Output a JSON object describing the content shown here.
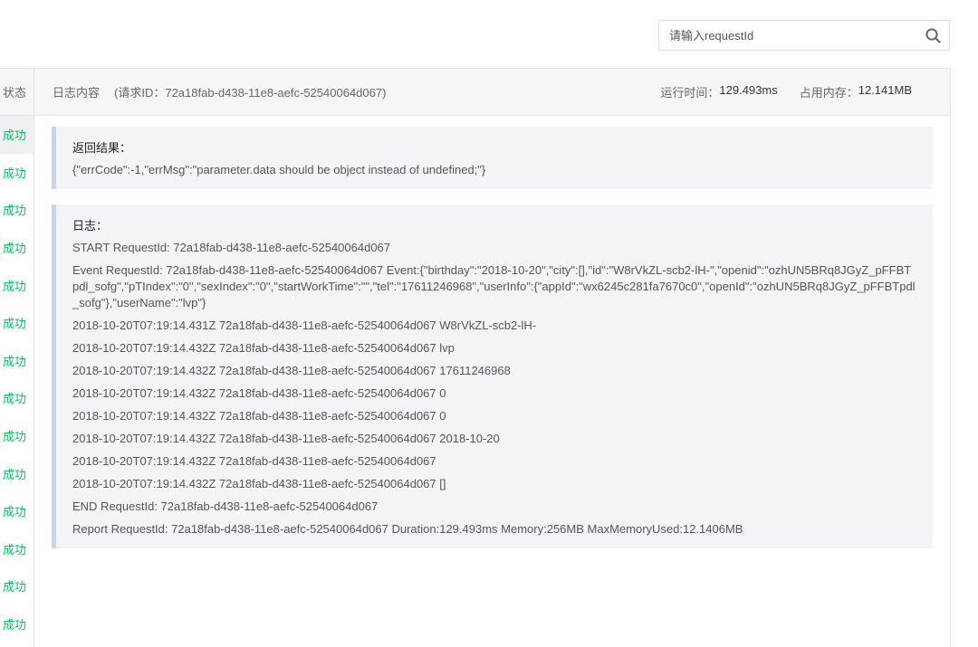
{
  "search": {
    "placeholder": "请输入requestId"
  },
  "status_column": {
    "header": "状态",
    "cells": [
      "成功",
      "成功",
      "成功",
      "成功",
      "成功",
      "成功",
      "成功",
      "成功",
      "成功",
      "成功",
      "成功",
      "成功",
      "成功",
      "成功"
    ]
  },
  "log_header": {
    "title": "日志内容",
    "request_id_text": "(请求ID：72a18fab-d438-11e8-aefc-52540064d067)",
    "runtime_label": "运行时间：",
    "runtime_value": "129.493ms",
    "memory_label": "占用内存：",
    "memory_value": "12.141MB"
  },
  "result_block": {
    "label": "返回结果：",
    "content": "{\"errCode\":-1,\"errMsg\":\"parameter.data should be object instead of undefined;\"}"
  },
  "log_block": {
    "label": "日志：",
    "lines": [
      "START RequestId: 72a18fab-d438-11e8-aefc-52540064d067",
      "Event RequestId: 72a18fab-d438-11e8-aefc-52540064d067 Event:{\"birthday\":\"2018-10-20\",\"city\":[],\"id\":\"W8rVkZL-scb2-lH-\",\"openid\":\"ozhUN5BRq8JGyZ_pFFBTpdl_sofg\",\"pTIndex\":\"0\",\"sexIndex\":\"0\",\"startWorkTime\":\"\",\"tel\":\"17611246968\",\"userInfo\":{\"appId\":\"wx6245c281fa7670c0\",\"openId\":\"ozhUN5BRq8JGyZ_pFFBTpdl_sofg\"},\"userName\":\"lvp\"}",
      "2018-10-20T07:19:14.431Z 72a18fab-d438-11e8-aefc-52540064d067 W8rVkZL-scb2-lH-",
      "2018-10-20T07:19:14.432Z 72a18fab-d438-11e8-aefc-52540064d067 lvp",
      "2018-10-20T07:19:14.432Z 72a18fab-d438-11e8-aefc-52540064d067 17611246968",
      "2018-10-20T07:19:14.432Z 72a18fab-d438-11e8-aefc-52540064d067 0",
      "2018-10-20T07:19:14.432Z 72a18fab-d438-11e8-aefc-52540064d067 0",
      "2018-10-20T07:19:14.432Z 72a18fab-d438-11e8-aefc-52540064d067 2018-10-20",
      "2018-10-20T07:19:14.432Z 72a18fab-d438-11e8-aefc-52540064d067",
      "2018-10-20T07:19:14.432Z 72a18fab-d438-11e8-aefc-52540064d067 []",
      "END RequestId: 72a18fab-d438-11e8-aefc-52540064d067",
      "Report RequestId: 72a18fab-d438-11e8-aefc-52540064d067 Duration:129.493ms Memory:256MB MaxMemoryUsed:12.1406MB"
    ]
  },
  "colors": {
    "success": "#07c160",
    "block_accent": "#c4d5ee",
    "header_bg": "#f5f6f8"
  },
  "icons": {
    "search": "search-icon"
  }
}
